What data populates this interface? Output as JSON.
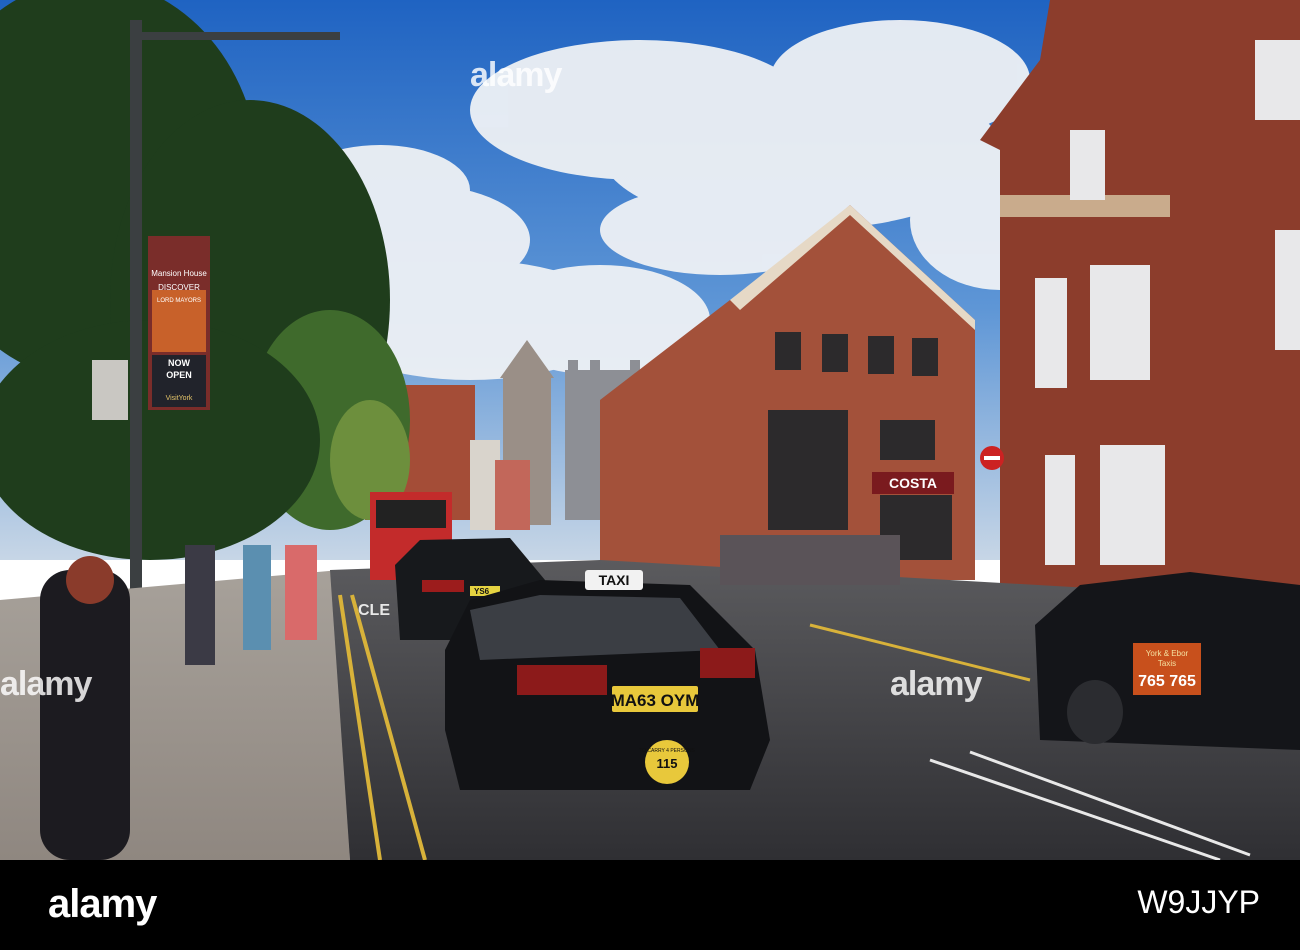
{
  "photo": {
    "banner": {
      "line1": "Mansion House",
      "line2": "DISCOVER",
      "line3": "LORD MAYORS",
      "line4": "NOW",
      "line5": "OPEN",
      "line6": "VisitYork"
    },
    "shop_sign": "COSTA",
    "taxi_roof_sign": "TAXI",
    "taxi_plate": "MA63 OYM",
    "taxi_badge_line1": "TO CARRY 4 PERSONS",
    "taxi_badge_number": "115",
    "car_plate_partial": "YS6",
    "right_taxi_door_line1": "York & Ebor",
    "right_taxi_door_line2": "Taxis",
    "right_taxi_door_number": "765 765",
    "bus_lane_marking": "CLE",
    "sky_color": "#2a72c9",
    "brick_color": "#a04a35"
  },
  "watermarks": [
    "alamy",
    "alamy",
    "alamy"
  ],
  "footer": {
    "logo": "alamy",
    "image_id": "W9JJYP"
  }
}
